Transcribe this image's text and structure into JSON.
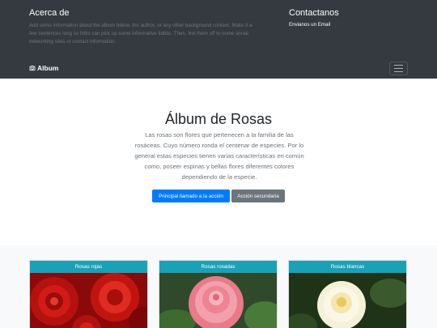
{
  "about": {
    "title": "Acerca de",
    "text": "Add some information about the album below, the author, or any other background context. Make it a few sentences long so folks can pick up some informative tidbits. Then, link them off to some social networking sites or contact information."
  },
  "contact": {
    "title": "Contactanos",
    "link": "Envianos un Email"
  },
  "navbar": {
    "brand": "Album",
    "brand_icon": "camera-icon",
    "toggler_icon": "hamburger-icon"
  },
  "hero": {
    "title": "Álbum de Rosas",
    "lead": "Las rosas son flores que pertenecen a la familia de las rosáceas. Cuyo número ronda el centenar de especies. Por lo general estas especies tienen varias características en común como, poseer espinas y bellas flores diferentes colores dependiendo de la especie.",
    "primary_button": "Principal llamado a la acción",
    "secondary_button": "Acción secundaria"
  },
  "cards": [
    {
      "title": "Rosas rojas",
      "image": "red-roses-photo"
    },
    {
      "title": "Rosas rosadas",
      "image": "pink-rose-photo"
    },
    {
      "title": "Rosas blancas",
      "image": "white-rose-photo"
    }
  ],
  "colors": {
    "dark": "#343a40",
    "primary": "#007bff",
    "secondary": "#6c757d",
    "info": "#17a2b8",
    "light": "#f8f9fa"
  }
}
